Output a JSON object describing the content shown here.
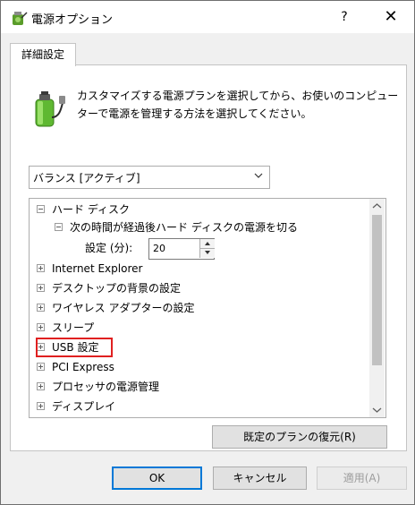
{
  "window": {
    "title": "電源オプション",
    "help_label": "?",
    "close_label": "✕"
  },
  "tab": {
    "label": "詳細設定"
  },
  "description": "カスタマイズする電源プランを選択してから、お使いのコンピューターで電源を管理する方法を選択してください。",
  "plan_select": {
    "value": "バランス [アクティブ]"
  },
  "tree": {
    "hard_disk": "ハード ディスク",
    "hard_disk_timeout": "次の時間が経過後ハード ディスクの電源を切る",
    "setting_label": "設定 (分):",
    "setting_value": "20",
    "internet_explorer": "Internet Explorer",
    "desktop_background": "デスクトップの背景の設定",
    "wireless_adapter": "ワイヤレス アダプターの設定",
    "sleep": "スリープ",
    "usb": "USB 設定",
    "pci_express": "PCI Express",
    "processor": "プロセッサの電源管理",
    "display": "ディスプレイ"
  },
  "buttons": {
    "restore": "既定のプランの復元(R)",
    "ok": "OK",
    "cancel": "キャンセル",
    "apply": "適用(A)"
  },
  "colors": {
    "highlight": "#e02020",
    "default_button_border": "#0078d7",
    "battery": "#5fb832"
  }
}
